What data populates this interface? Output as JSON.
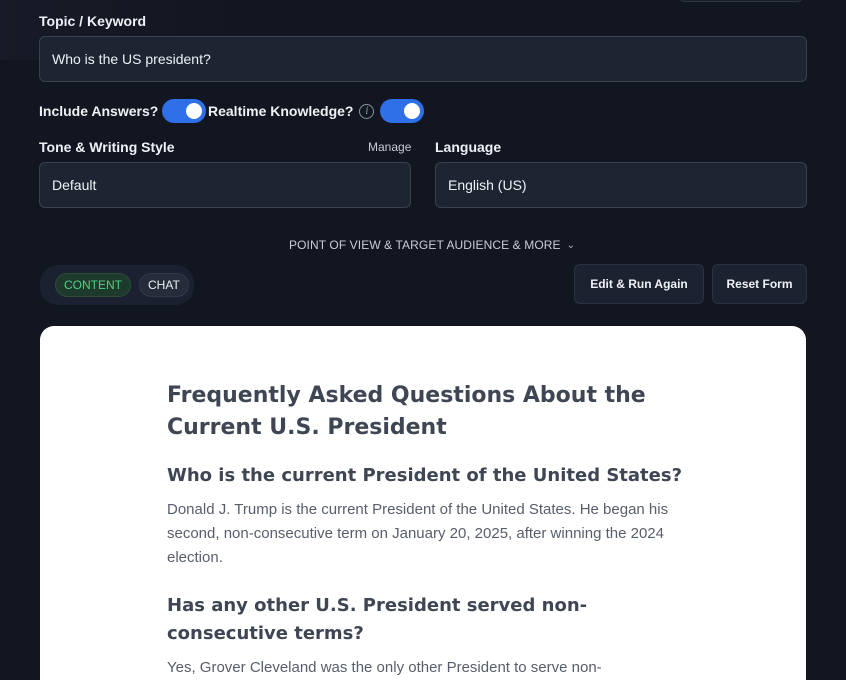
{
  "form": {
    "topic_label": "Topic / Keyword",
    "topic_value": "Who is the US president?",
    "include_answers_label": "Include Answers?",
    "include_answers_on": true,
    "realtime_label": "Realtime Knowledge?",
    "realtime_on": true,
    "info_glyph": "i",
    "tone_label": "Tone & Writing Style",
    "manage_label": "Manage",
    "tone_value": "Default",
    "language_label": "Language",
    "language_value": "English (US)",
    "more_options_label": "POINT OF VIEW & TARGET AUDIENCE & MORE",
    "chevron_glyph": "⌄"
  },
  "view_tabs": {
    "content_label": "CONTENT",
    "chat_label": "CHAT",
    "active": "CONTENT"
  },
  "actions": {
    "edit_run_label": "Edit & Run Again",
    "reset_label": "Reset Form"
  },
  "document": {
    "title": "Frequently Asked Questions About the Current U.S. President",
    "q1": "Who is the current President of the United States?",
    "a1": "Donald J. Trump is the current President of the United States. He began his second, non-consecutive term on January 20, 2025, after winning the 2024 election.",
    "q2": "Has any other U.S. President served non-consecutive terms?",
    "a2": "Yes, Grover Cleveland was the only other President to serve non-"
  },
  "colors": {
    "background": "#121620",
    "toggle_on": "#2f6fe8",
    "active_tab_text": "#4ed17f"
  }
}
